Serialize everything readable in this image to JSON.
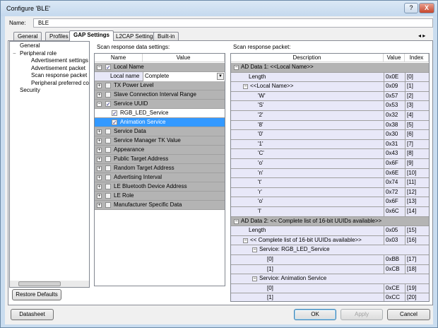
{
  "window": {
    "title": "Configure 'BLE'",
    "help": "?",
    "close": "X"
  },
  "name_label": "Name:",
  "name_value": "BLE",
  "tabs": [
    {
      "label": "General"
    },
    {
      "label": "Profiles"
    },
    {
      "label": "GAP Settings",
      "active": true
    },
    {
      "label": "L2CAP Settings"
    },
    {
      "label": "Built-in"
    }
  ],
  "tab_scroll": "◂ ▸",
  "tree": [
    {
      "label": "General",
      "level": 0
    },
    {
      "label": "Peripheral role",
      "level": 0,
      "expander": "−"
    },
    {
      "label": "Advertisement settings",
      "level": 1
    },
    {
      "label": "Advertisement packet",
      "level": 1
    },
    {
      "label": "Scan response packet",
      "level": 1
    },
    {
      "label": "Peripheral preferred conne",
      "level": 1
    },
    {
      "label": "Security",
      "level": 0
    }
  ],
  "restore_defaults": "Restore Defaults",
  "settings": {
    "label": "Scan response data settings:",
    "col_name": "Name",
    "col_value": "Value",
    "rows": [
      {
        "label": "Local Name",
        "type": "group",
        "checked": true,
        "expander": "−"
      },
      {
        "label": "Local name",
        "type": "sub",
        "value": "Complete"
      },
      {
        "label": "TX Power Level",
        "type": "group",
        "checked": false,
        "expander": "+"
      },
      {
        "label": "Slave Connection Interval Range",
        "type": "group",
        "checked": false,
        "expander": "+"
      },
      {
        "label": "Service UUID",
        "type": "group",
        "checked": true,
        "expander": "−"
      },
      {
        "label": "RGB_LED_Service",
        "type": "child",
        "checked": true
      },
      {
        "label": "Animation Service",
        "type": "child",
        "checked": true,
        "selected": true
      },
      {
        "label": "Service Data",
        "type": "group",
        "checked": false,
        "expander": "+"
      },
      {
        "label": "Service Manager TK Value",
        "type": "group",
        "checked": false,
        "expander": "+"
      },
      {
        "label": "Appearance",
        "type": "group",
        "checked": false,
        "expander": "+"
      },
      {
        "label": "Public Target Address",
        "type": "group",
        "checked": false,
        "expander": "+"
      },
      {
        "label": "Random Target Address",
        "type": "group",
        "checked": false,
        "expander": "+"
      },
      {
        "label": "Advertising Interval",
        "type": "group",
        "checked": false,
        "expander": "+"
      },
      {
        "label": "LE Bluetooth Device Address",
        "type": "group",
        "checked": false,
        "expander": "+"
      },
      {
        "label": "LE Role",
        "type": "group",
        "checked": false,
        "expander": "+"
      },
      {
        "label": "Manufacturer Specific Data",
        "type": "group",
        "checked": false,
        "expander": "+"
      }
    ]
  },
  "packet": {
    "label": "Scan response packet:",
    "col_desc": "Description",
    "col_value": "Value",
    "col_index": "Index",
    "rows": [
      {
        "desc": "AD Data 1: <<Local Name>>",
        "level": 0,
        "group": true,
        "expander": "−"
      },
      {
        "desc": "Length",
        "level": 1,
        "value": "0x0E",
        "index": "[0]"
      },
      {
        "desc": "<<Local Name>>",
        "level": 1,
        "value": "0x09",
        "index": "[1]",
        "expander": "−"
      },
      {
        "desc": "'W'",
        "level": 2,
        "value": "0x57",
        "index": "[2]"
      },
      {
        "desc": "'S'",
        "level": 2,
        "value": "0x53",
        "index": "[3]"
      },
      {
        "desc": "'2'",
        "level": 2,
        "value": "0x32",
        "index": "[4]"
      },
      {
        "desc": "'8'",
        "level": 2,
        "value": "0x38",
        "index": "[5]"
      },
      {
        "desc": "'0'",
        "level": 2,
        "value": "0x30",
        "index": "[6]"
      },
      {
        "desc": "'1'",
        "level": 2,
        "value": "0x31",
        "index": "[7]"
      },
      {
        "desc": "'C'",
        "level": 2,
        "value": "0x43",
        "index": "[8]"
      },
      {
        "desc": "'o'",
        "level": 2,
        "value": "0x6F",
        "index": "[9]"
      },
      {
        "desc": "'n'",
        "level": 2,
        "value": "0x6E",
        "index": "[10]"
      },
      {
        "desc": "'t'",
        "level": 2,
        "value": "0x74",
        "index": "[11]"
      },
      {
        "desc": "'r'",
        "level": 2,
        "value": "0x72",
        "index": "[12]"
      },
      {
        "desc": "'o'",
        "level": 2,
        "value": "0x6F",
        "index": "[13]"
      },
      {
        "desc": "'l'",
        "level": 2,
        "value": "0x6C",
        "index": "[14]"
      },
      {
        "desc": "AD Data 2: << Complete list of 16-bit UUIDs available>>",
        "level": 0,
        "group": true,
        "expander": "−"
      },
      {
        "desc": "Length",
        "level": 1,
        "value": "0x05",
        "index": "[15]"
      },
      {
        "desc": "<< Complete list of 16-bit UUIDs available>>",
        "level": 1,
        "value": "0x03",
        "index": "[16]",
        "expander": "−"
      },
      {
        "desc": "Service: RGB_LED_Service",
        "level": 2,
        "expander": "−",
        "span": true
      },
      {
        "desc": "[0]",
        "level": 3,
        "value": "0xBB",
        "index": "[17]"
      },
      {
        "desc": "[1]",
        "level": 3,
        "value": "0xCB",
        "index": "[18]"
      },
      {
        "desc": "Service: Animation Service",
        "level": 2,
        "expander": "−",
        "span": true
      },
      {
        "desc": "[0]",
        "level": 3,
        "value": "0xCE",
        "index": "[19]"
      },
      {
        "desc": "[1]",
        "level": 3,
        "value": "0xCC",
        "index": "[20]"
      }
    ]
  },
  "buttons": {
    "datasheet": "Datasheet",
    "ok": "OK",
    "apply": "Apply",
    "cancel": "Cancel"
  }
}
